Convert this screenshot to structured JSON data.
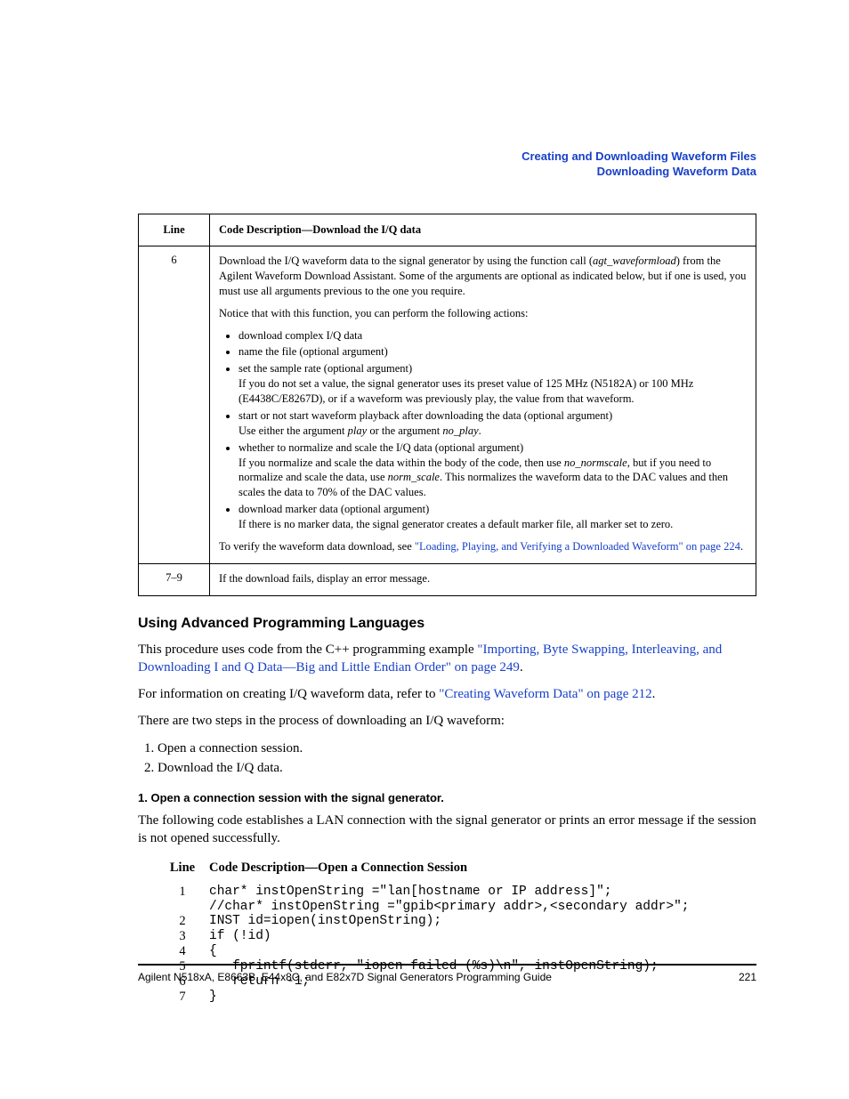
{
  "header": {
    "line1": "Creating and Downloading Waveform Files",
    "line2": "Downloading Waveform Data"
  },
  "table1": {
    "col_line": "Line",
    "col_desc": "Code Description—Download the I/Q data",
    "r1": {
      "line": "6",
      "p1a": "Download the I/Q waveform data to the signal generator by using the function call (",
      "p1b": "agt_waveformload",
      "p1c": ") from the Agilent Waveform Download Assistant. Some of the arguments are optional as indicated below, but if one is used, you must use all arguments previous to the one you require.",
      "p2": "Notice that with this function, you can perform the following actions:",
      "b1": "download complex I/Q data",
      "b2": "name the file (optional argument)",
      "b3a": "set the sample rate (optional argument)",
      "b3b": "If you do not set a value, the signal generator uses its preset value of 125 MHz (N5182A) or 100 MHz (E4438C/E8267D), or if a waveform was previously play, the value from that waveform.",
      "b4a": "start or not start waveform playback after downloading the data (optional argument)",
      "b4b1": "Use either the argument ",
      "b4b2": "play",
      "b4b3": " or the argument ",
      "b4b4": "no_play",
      "b4b5": ".",
      "b5a": "whether to normalize and scale the I/Q data (optional argument)",
      "b5b1": "If you normalize and scale the data within the body of the code, then use ",
      "b5b2": "no_normscale",
      "b5b3": ", but if you need to normalize and scale the data, use ",
      "b5b4": "norm_scale",
      "b5b5": ". This normalizes the waveform data to the DAC values and then scales the data to 70% of the DAC values.",
      "b6a": "download marker data (optional argument)",
      "b6b": "If there is no marker data, the signal generator creates a default marker file, all marker set to zero.",
      "p3a": "To verify the waveform data download, see ",
      "p3b": "\"Loading, Playing, and Verifying a Downloaded Waveform\" on page 224",
      "p3c": "."
    },
    "r2": {
      "line": "7–9",
      "p1": "If the download fails, display an error message."
    }
  },
  "heading2": "Using Advanced Programming Languages",
  "para1a": "This procedure uses code from the C++ programming example ",
  "para1b": "\"Importing, Byte Swapping, Interleaving, and Downloading I and Q Data—Big and Little Endian Order\" on page 249",
  "para1c": ".",
  "para2a": "For information on creating I/Q waveform data, refer to ",
  "para2b": "\"Creating Waveform Data\" on page 212",
  "para2c": ".",
  "para3": "There are two steps in the process of downloading an I/Q waveform:",
  "step1": "Open a connection session.",
  "step2": "Download the I/Q data.",
  "sub1": "1. Open a connection session with the signal generator.",
  "para4": "The following code establishes a LAN connection with the signal generator or prints an error message if the session is not opened successfully.",
  "code": {
    "hdr_line": "Line",
    "hdr_desc": "Code Description—Open a Connection Session",
    "l1": "1",
    "c1": "char* instOpenString =\"lan[hostname or IP address]\";",
    "c1b": "//char* instOpenString =\"gpib<primary addr>,<secondary addr>\";",
    "l2": "2",
    "c2": "INST id=iopen(instOpenString);",
    "l3": "3",
    "c3": "if (!id)",
    "l4": "4",
    "c4": "{",
    "l5": "5",
    "c5": "   fprintf(stderr, \"iopen failed (%s)\\n\", instOpenString);",
    "l6": "6",
    "c6": "   return -1;",
    "l7": "7",
    "c7": "}"
  },
  "footer": {
    "left": "Agilent N518xA, E8663B, E44x8C, and E82x7D Signal Generators Programming Guide",
    "right": "221"
  }
}
